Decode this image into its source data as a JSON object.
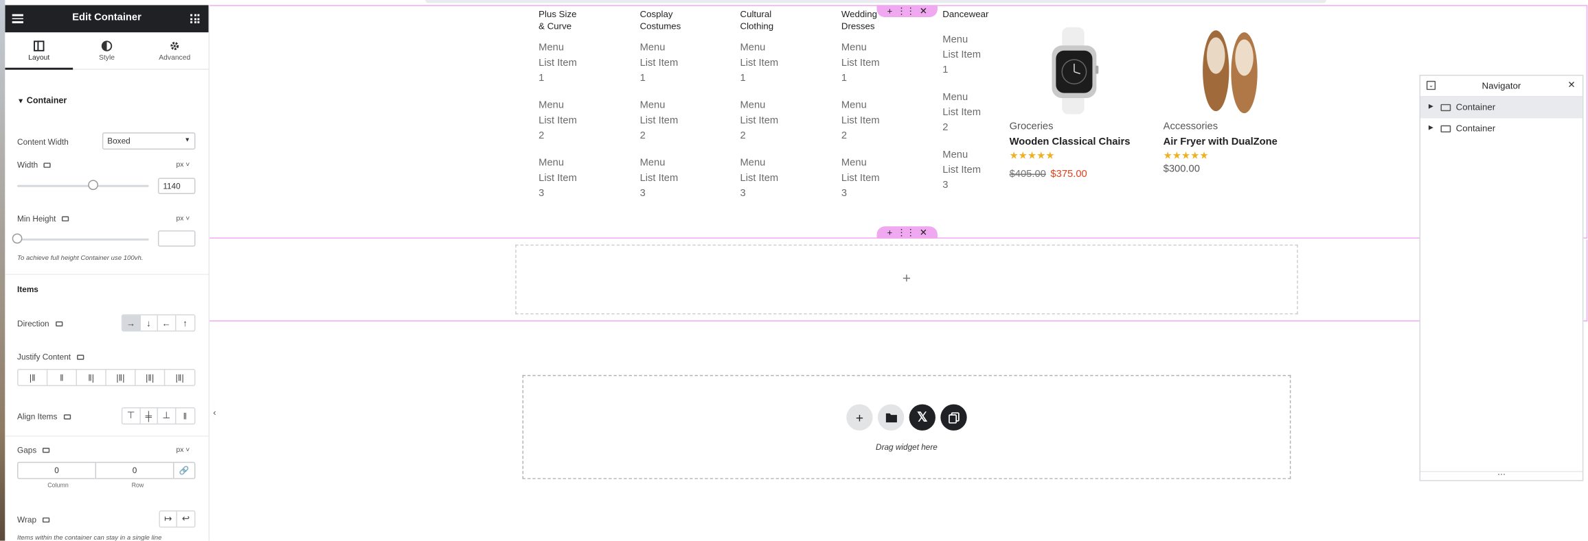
{
  "panel": {
    "title": "Edit Container",
    "tabs": [
      {
        "label": "Layout"
      },
      {
        "label": "Style"
      },
      {
        "label": "Advanced"
      }
    ],
    "section": "Container",
    "content_width": {
      "label": "Content Width",
      "value": "Boxed"
    },
    "width": {
      "label": "Width",
      "unit": "px",
      "value": "1140",
      "slider_fraction": 0.58
    },
    "min_height": {
      "label": "Min Height",
      "unit": "px",
      "value": "",
      "hint": "To achieve full height Container use 100vh.",
      "slider_fraction": 0
    },
    "items_heading": "Items",
    "direction": {
      "label": "Direction",
      "options": [
        "→",
        "↓",
        "←",
        "↑"
      ],
      "selected": 0
    },
    "justify": {
      "label": "Justify Content"
    },
    "align": {
      "label": "Align Items"
    },
    "gaps": {
      "label": "Gaps",
      "unit": "px",
      "column": "0",
      "row": "0",
      "column_label": "Column",
      "row_label": "Row"
    },
    "wrap": {
      "label": "Wrap",
      "hint": "Items within the container can stay in a single line"
    }
  },
  "canvas": {
    "menus": [
      {
        "title1": "Plus Size",
        "title2": "& Curve"
      },
      {
        "title1": "Cosplay",
        "title2": "Costumes"
      },
      {
        "title1": "Cultural",
        "title2": "Clothing"
      },
      {
        "title1": "Wedding",
        "title2": "Dresses"
      },
      {
        "title1": "Dancewear",
        "title2": ""
      }
    ],
    "menu_item_lines": [
      "Menu",
      "List Item"
    ],
    "menu_item_numbers": [
      "1",
      "2",
      "3"
    ],
    "products": [
      {
        "category": "Groceries",
        "name": "Wooden Classical Chairs",
        "stars": "★★★★★",
        "old_price": "$405.00",
        "price": "$375.00",
        "image": "smartwatch"
      },
      {
        "category": "Accessories",
        "name": "Air Fryer with DualZone",
        "stars": "★★★★★",
        "price": "$300.00",
        "image": "loafers"
      }
    ],
    "drop_text": "Drag widget here",
    "handle_icons": [
      "+",
      "⋮⋮",
      "✕"
    ]
  },
  "navigator": {
    "title": "Navigator",
    "items": [
      {
        "label": "Container"
      },
      {
        "label": "Container"
      }
    ],
    "footer": "⋯"
  },
  "colors": {
    "accent_pink": "#f0a8f0",
    "dark": "#1f2124",
    "star": "#f2b01e",
    "sale": "#e2401c"
  }
}
